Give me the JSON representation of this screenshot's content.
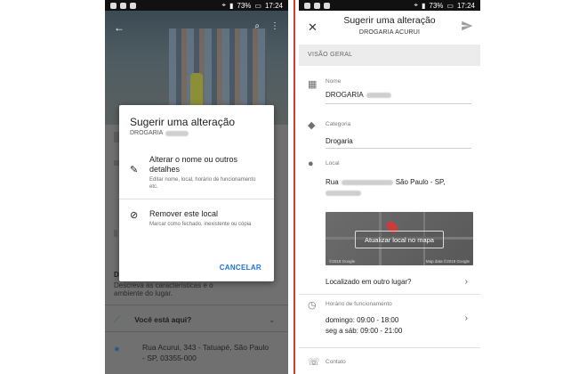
{
  "status_bar": {
    "battery": "73%",
    "time": "17:24"
  },
  "left": {
    "dialog": {
      "title": "Sugerir uma alteração",
      "subtitle": "DROGARIA",
      "options": [
        {
          "icon": "pencil-icon",
          "title": "Alterar o nome ou outros detalhes",
          "desc": "Editar nome, local, horário de funcionamento etc."
        },
        {
          "icon": "location-off-icon",
          "title": "Remover este local",
          "desc": "Marcar como fechado, inexistente ou cópia"
        }
      ],
      "cancel": "CANCELAR"
    },
    "background": {
      "desc_line1": "Descreva as características e o",
      "desc_line2": "ambiente do lugar.",
      "question": "Você está aqui?",
      "address_line1": "Rua Acurui, 343 - Tatuapé, São Paulo",
      "address_line2": "- SP, 03355-000"
    }
  },
  "right": {
    "header": {
      "title": "Sugerir uma alteração",
      "subtitle": "DROGARIA ACURUI"
    },
    "section": "VISÃO GERAL",
    "name": {
      "label": "Nome",
      "value": "DROGARIA"
    },
    "category": {
      "label": "Categoria",
      "value": "Drogaria"
    },
    "location": {
      "label": "Local",
      "value_prefix": "Rua",
      "value_suffix": "São Paulo - SP,"
    },
    "map": {
      "button": "Atualizar local no mapa",
      "footer_right": "Map data ©2018 Google"
    },
    "elsewhere": "Localizado em outro lugar?",
    "hours": {
      "label": "Horário de funcionamento",
      "line1": "domingo: 09:00 - 18:00",
      "line2": "seg a sáb: 09:00 - 21:00"
    },
    "contact": {
      "label": "Contato"
    }
  }
}
